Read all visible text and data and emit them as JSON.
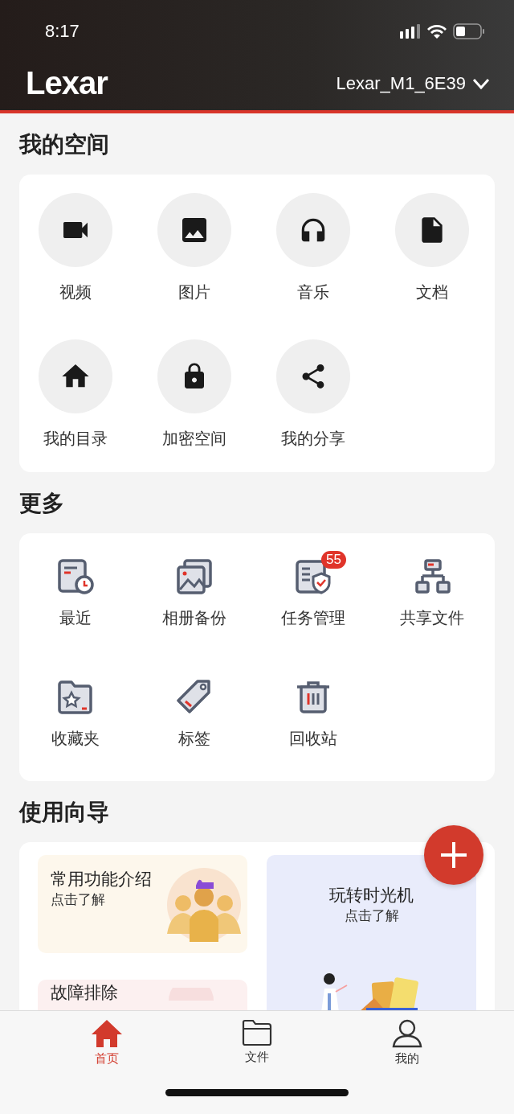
{
  "status_bar": {
    "time": "8:17"
  },
  "header": {
    "logo": "Lexar",
    "device": "Lexar_M1_6E39"
  },
  "my_space": {
    "title": "我的空间",
    "items": [
      {
        "kind": "video",
        "label": "视频"
      },
      {
        "kind": "image",
        "label": "图片"
      },
      {
        "kind": "music",
        "label": "音乐"
      },
      {
        "kind": "document",
        "label": "文档"
      },
      {
        "kind": "home",
        "label": "我的目录"
      },
      {
        "kind": "lock",
        "label": "加密空间"
      },
      {
        "kind": "share",
        "label": "我的分享"
      }
    ]
  },
  "more": {
    "title": "更多",
    "items": [
      {
        "kind": "recent",
        "label": "最近"
      },
      {
        "kind": "album",
        "label": "相册备份"
      },
      {
        "kind": "tasks",
        "label": "任务管理",
        "badge": "55"
      },
      {
        "kind": "network",
        "label": "共享文件"
      },
      {
        "kind": "favorites",
        "label": "收藏夹"
      },
      {
        "kind": "tag",
        "label": "标签"
      },
      {
        "kind": "trash",
        "label": "回收站"
      }
    ]
  },
  "guide": {
    "title": "使用向导",
    "cards": [
      {
        "kind": "features",
        "title": "常用功能介绍",
        "subtitle": "点击了解"
      },
      {
        "kind": "timemachine",
        "title": "玩转时光机",
        "subtitle": "点击了解"
      },
      {
        "kind": "trouble",
        "title": "故障排除"
      }
    ]
  },
  "tab_bar": [
    {
      "kind": "home",
      "label": "首页",
      "selected": true
    },
    {
      "kind": "files",
      "label": "文件",
      "selected": false
    },
    {
      "kind": "me",
      "label": "我的",
      "selected": false
    }
  ]
}
